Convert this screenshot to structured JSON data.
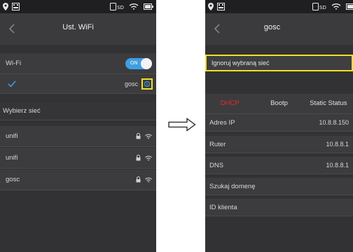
{
  "left": {
    "title": "Ust. WiFi",
    "wifi_label": "Wi-Fi",
    "toggle_label": "ON",
    "connected_ssid": "gosc",
    "choose_network_label": "Wybierz sieć",
    "networks": [
      "unifi",
      "unifi",
      "gosc"
    ]
  },
  "right": {
    "title": "gosc",
    "ignore_label": "Ignoruj wybraną sieć",
    "tabs": [
      "DHCP",
      "Bootp",
      "Static Status"
    ],
    "active_tab": "DHCP",
    "rows": [
      {
        "label": "Adres IP",
        "value": "10.8.8.150"
      },
      {
        "label": "Ruter",
        "value": "10.8.8.1"
      },
      {
        "label": "DNS",
        "value": "10.8.8.1"
      },
      {
        "label": "Szukaj domenę",
        "value": ""
      },
      {
        "label": "ID klienta",
        "value": ""
      }
    ]
  },
  "colors": {
    "accent_blue": "#3f9fe0",
    "highlight_yellow": "#f0e020",
    "active_tab_red": "#e52b2b",
    "background_dark": "#323235"
  },
  "icons": [
    "location-pin-icon",
    "keyboard-icon",
    "sd-card-icon",
    "wifi-icon",
    "battery-icon",
    "back-chevron-icon",
    "checkmark-icon",
    "info-icon",
    "lock-icon",
    "arrow-right-icon"
  ]
}
